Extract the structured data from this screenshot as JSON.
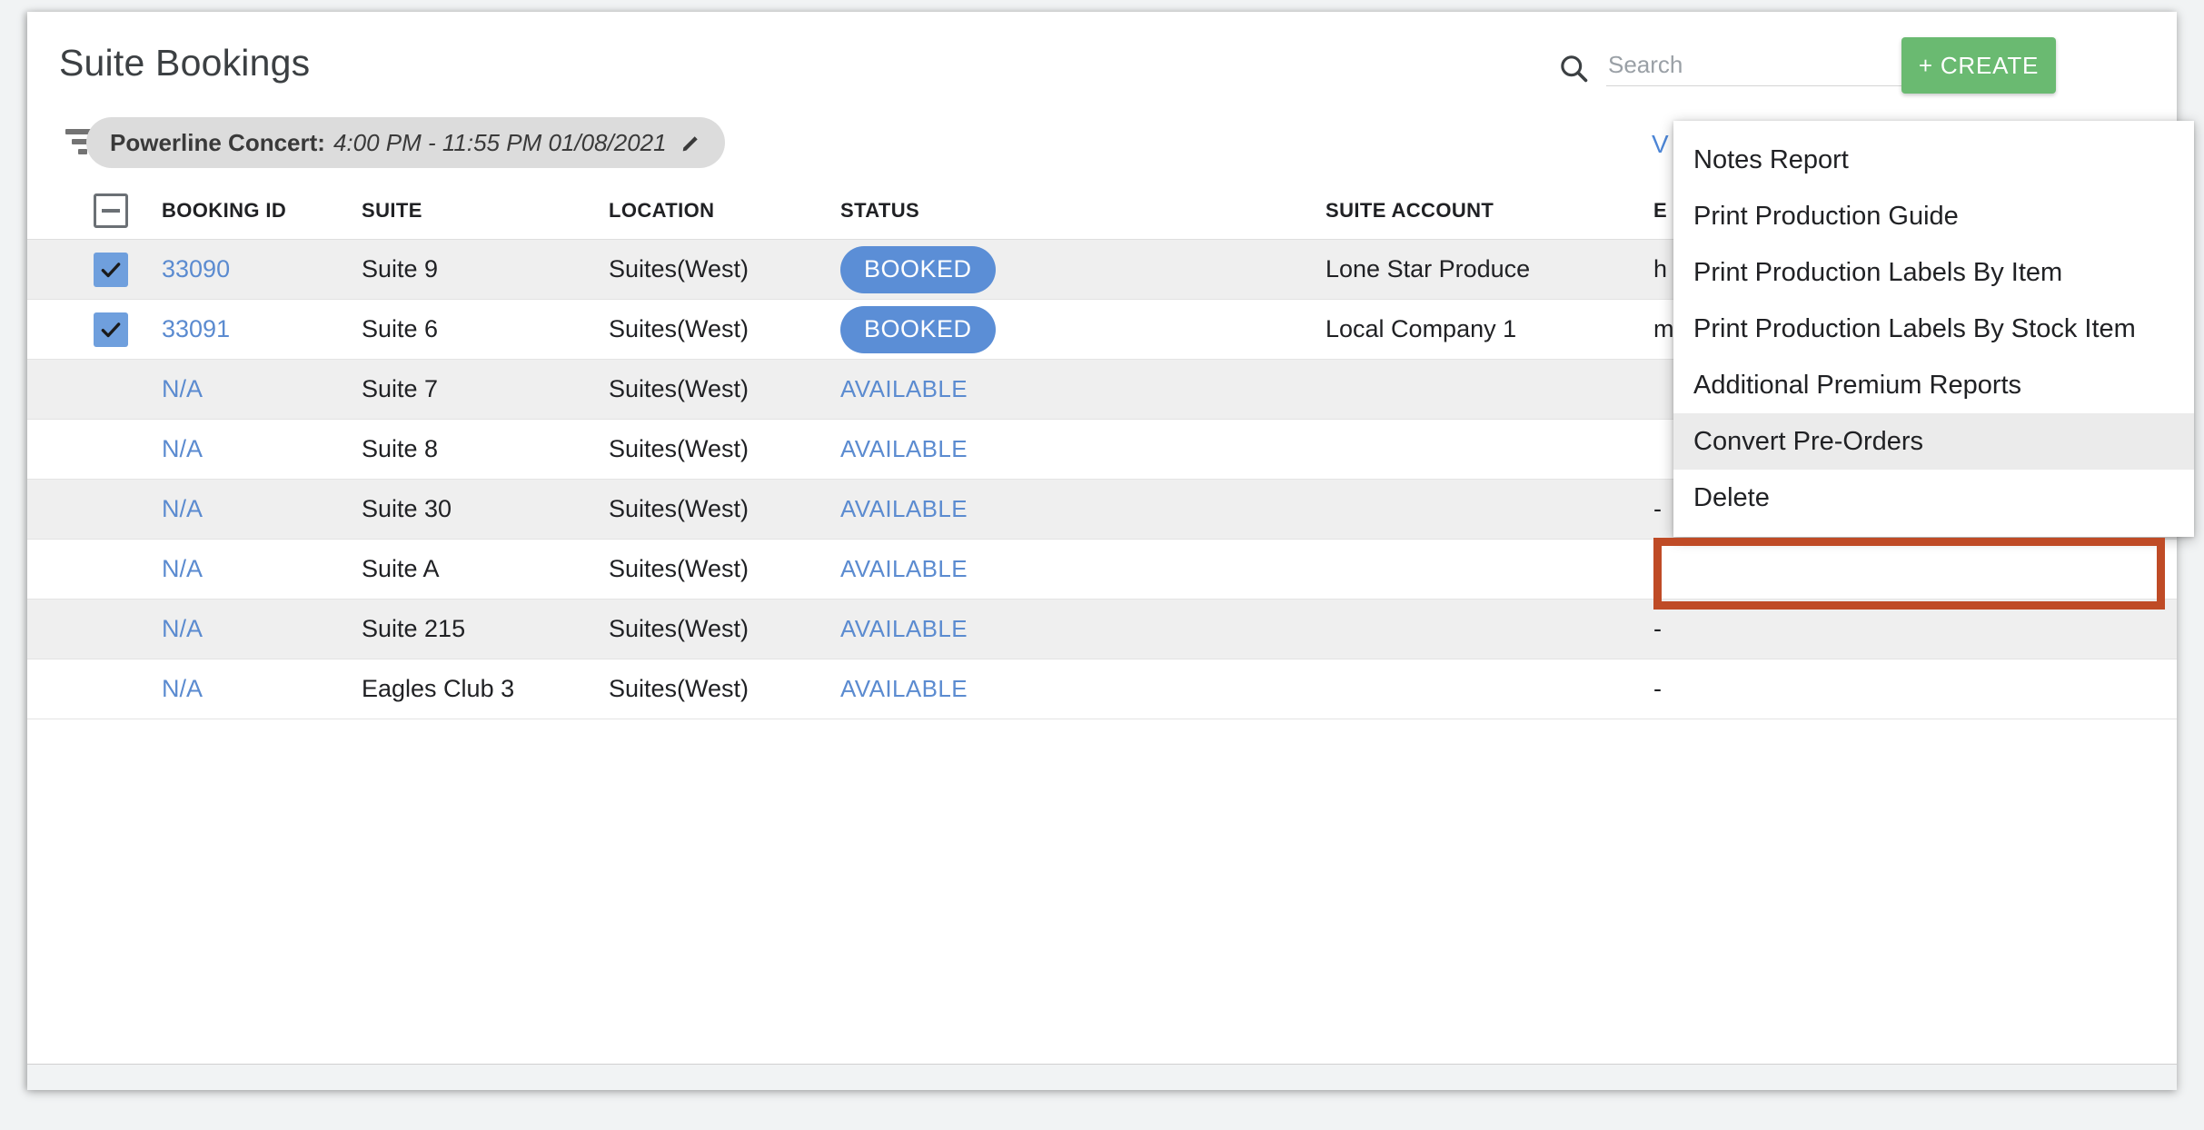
{
  "header": {
    "title": "Suite Bookings",
    "search": {
      "placeholder": "Search",
      "value": ""
    },
    "create_label": "+ CREATE",
    "search_icon": "search-icon"
  },
  "filter_bar": {
    "filter_icon": "filter-icon",
    "chip": {
      "name": "Powerline Concert:",
      "time": "4:00 PM - 11:55 PM 01/08/2021",
      "edit_icon": "pencil-icon"
    },
    "view_link": "V"
  },
  "table": {
    "columns": [
      "BOOKING ID",
      "SUITE",
      "LOCATION",
      "STATUS",
      "SUITE ACCOUNT",
      "E"
    ],
    "header_checkbox_state": "indeterminate",
    "rows": [
      {
        "checked": true,
        "booking_id": "33090",
        "suite": "Suite 9",
        "location": "Suites(West)",
        "status": "BOOKED",
        "status_type": "badge",
        "suite_account": "Lone Star Produce",
        "email": "h"
      },
      {
        "checked": true,
        "booking_id": "33091",
        "suite": "Suite 6",
        "location": "Suites(West)",
        "status": "BOOKED",
        "status_type": "badge",
        "suite_account": "Local Company 1",
        "email": "m"
      },
      {
        "checked": false,
        "booking_id": "N/A",
        "suite": "Suite 7",
        "location": "Suites(West)",
        "status": "AVAILABLE",
        "status_type": "text",
        "suite_account": "",
        "email": ""
      },
      {
        "checked": false,
        "booking_id": "N/A",
        "suite": "Suite 8",
        "location": "Suites(West)",
        "status": "AVAILABLE",
        "status_type": "text",
        "suite_account": "",
        "email": ""
      },
      {
        "checked": false,
        "booking_id": "N/A",
        "suite": "Suite 30",
        "location": "Suites(West)",
        "status": "AVAILABLE",
        "status_type": "text",
        "suite_account": "",
        "email": "-"
      },
      {
        "checked": false,
        "booking_id": "N/A",
        "suite": "Suite A",
        "location": "Suites(West)",
        "status": "AVAILABLE",
        "status_type": "text",
        "suite_account": "",
        "email": "-"
      },
      {
        "checked": false,
        "booking_id": "N/A",
        "suite": "Suite 215",
        "location": "Suites(West)",
        "status": "AVAILABLE",
        "status_type": "text",
        "suite_account": "",
        "email": "-"
      },
      {
        "checked": false,
        "booking_id": "N/A",
        "suite": "Eagles Club 3",
        "location": "Suites(West)",
        "status": "AVAILABLE",
        "status_type": "text",
        "suite_account": "",
        "email": "-"
      }
    ]
  },
  "actions_menu": {
    "items": [
      {
        "label": "Notes Report",
        "active": false
      },
      {
        "label": "Print Production Guide",
        "active": false
      },
      {
        "label": "Print Production Labels By Item",
        "active": false
      },
      {
        "label": "Print Production Labels By Stock Item",
        "active": false
      },
      {
        "label": "Additional Premium Reports",
        "active": false
      },
      {
        "label": "Convert Pre-Orders",
        "active": true
      },
      {
        "label": "Delete",
        "active": false
      }
    ],
    "highlighted_item": "Convert Pre-Orders"
  },
  "colors": {
    "create_button": "#6aba71",
    "link_blue": "#5b8bd0",
    "badge_blue": "#5b8ed6",
    "checkbox_blue": "#6f9fdd",
    "annotation_red": "#bf4b26",
    "zebra_gray": "#efefef"
  }
}
